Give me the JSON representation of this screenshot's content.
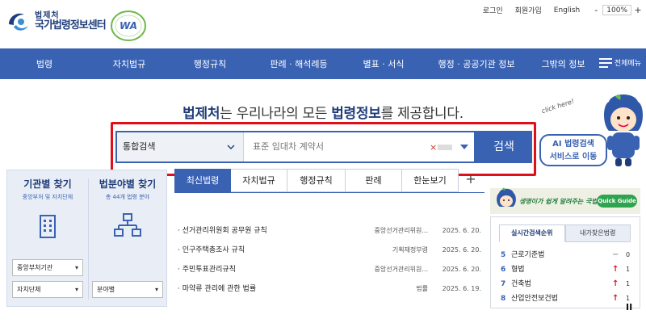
{
  "header": {
    "logo_small": "법제처",
    "logo_big": "국가법령정보센터",
    "wa_label": "WA",
    "utility": {
      "login": "로그인",
      "signup": "회원가입",
      "language": "English"
    },
    "zoom": {
      "minus": "-",
      "value": "100%",
      "plus": "+"
    }
  },
  "nav": {
    "items": [
      {
        "label": "법령"
      },
      {
        "label": "자치법규"
      },
      {
        "label": "행정규칙"
      },
      {
        "label": "판례 · 해석례등"
      },
      {
        "label": "별표 · 서식"
      },
      {
        "label": "행정 · 공공기관 정보"
      },
      {
        "label": "그밖의 정보"
      }
    ],
    "all_menu": "전체메뉴"
  },
  "hero": {
    "tagline_brand": "법제처",
    "tagline_mid": "는 우리나라의 모든 ",
    "tagline_strong": "법령정보",
    "tagline_end": "를 제공합니다.",
    "search": {
      "scope_value": "통합검색",
      "placeholder": "표준 임대차 계약서",
      "clear": "×",
      "button": "검색"
    }
  },
  "ai_banner": {
    "click_text": "click here!",
    "line1": "AI 법령검색",
    "line2": "서비스로 이동"
  },
  "finder": {
    "agency": {
      "title": "기관별 찾기",
      "subtitle": "중앙부처 및 자치단체",
      "select1": "중앙부처기관",
      "select2": "자치단체"
    },
    "field": {
      "title": "법분야별 찾기",
      "subtitle": "총 44개 법령 분야",
      "select1": "분야별"
    }
  },
  "tabs": {
    "items": [
      {
        "label": "최신법령"
      },
      {
        "label": "자치법규"
      },
      {
        "label": "행정규칙"
      },
      {
        "label": "판례"
      },
      {
        "label": "한눈보기"
      }
    ],
    "plus": "+"
  },
  "news": [
    {
      "title": "· 선거관리위원회 공무원 규칙",
      "org": "중앙선거관리위원...",
      "date": "2025. 6. 20."
    },
    {
      "title": "· 인구주택총조사 규칙",
      "org": "기획재정부령",
      "date": "2025. 6. 20."
    },
    {
      "title": "· 주민투표관리규칙",
      "org": "중앙선거관리위원...",
      "date": "2025. 6. 20."
    },
    {
      "title": "· 마약류 관리에 관한 법률",
      "org": "법률",
      "date": "2025. 6. 19."
    }
  ],
  "quick": {
    "text": "생명이가 쉽게 알려주는 국법",
    "button": "Quick Guide"
  },
  "rank": {
    "tabs": [
      {
        "label": "실시간검색순위"
      },
      {
        "label": "내가찾은법령"
      }
    ],
    "items": [
      {
        "num": "5",
        "name": "근로기준법",
        "arrow": "−",
        "trend": "flat",
        "delta": "0"
      },
      {
        "num": "6",
        "name": "형법",
        "arrow": "↑",
        "trend": "up",
        "delta": "1"
      },
      {
        "num": "7",
        "name": "건축법",
        "arrow": "↑",
        "trend": "up",
        "delta": "1"
      },
      {
        "num": "8",
        "name": "산업안전보건법",
        "arrow": "↑",
        "trend": "up",
        "delta": "1"
      }
    ],
    "pause": "II"
  },
  "colors": {
    "primary": "#3a62b3",
    "navy": "#1f3d7a",
    "highlight_frame": "#e0101a",
    "quick_green": "#2ea44f"
  }
}
